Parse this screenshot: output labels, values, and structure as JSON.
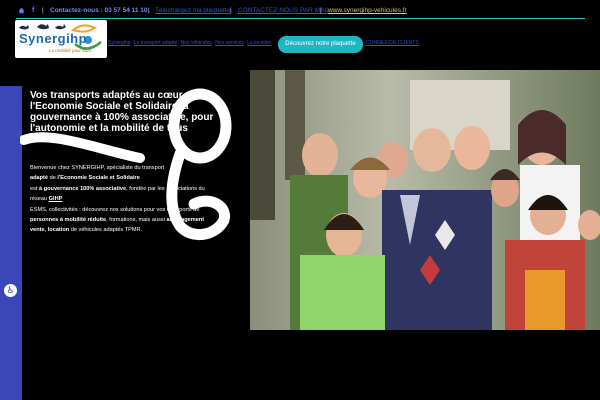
{
  "topbar": {
    "facebook_label": "f",
    "separator": "|",
    "contact": "Contactez-nous : 03 57 54 11 10",
    "link1": "Téléchargez ma plaquette",
    "link2": "CONTACTEZ-NOUS PAR MAIL",
    "site": "www.synergihp-vehicules.fr"
  },
  "logo": {
    "brand": "Synergihp",
    "tagline": "La mobilité pour tous"
  },
  "nav": {
    "items": [
      "Synergihp",
      "Le transport adapté",
      "Nos véhicules",
      "Nos services",
      "La location"
    ],
    "right_item": "CONNEXION CLIENTS"
  },
  "cta": {
    "label": "Découvrez notre plaquette"
  },
  "hero": {
    "headline": "Vos transports adaptés au cœur de l'Economie Sociale et Solidaire, à gouvernance à 100% associative, pour l'autonomie et la mobilité de tous",
    "intro": {
      "p1": "Bienvenue chez SYNERGIHP, ",
      "p1_rest": "spécialiste du transport",
      "p2_bold": "adapté",
      "p2": " de ",
      "p2_bold2": "l'Economie Sociale et Solidaire",
      "p3": "est ",
      "p3_bold": "à gouvernance 100% associative",
      "p3_rest": ", fondée par les associations du",
      "p4": "réseau ",
      "p4_link": "GIHP",
      "p5": "ESMS, collectivités : découvrez nos solutions pour vos transports de",
      "p6_bold": "personnes à mobilité réduite",
      "p6": ", formations, mais aussi ",
      "p6_bold2": "aménagement",
      "p7_bold": "vente",
      "p7": ", ",
      "p7_bold2": "location",
      "p7_rest": " de véhicules adaptés TPMR."
    }
  },
  "accessibility": {
    "icon": "accessibility-icon"
  },
  "colors": {
    "background": "#000000",
    "accent": "#3b47b8",
    "cta": "#1fb6c4",
    "divider": "#2ec0c9",
    "link": "#2f4fd6"
  }
}
